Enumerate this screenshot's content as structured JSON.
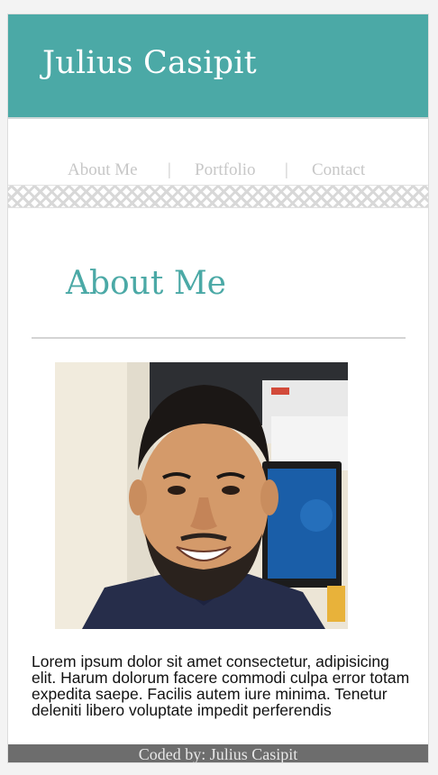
{
  "header": {
    "title": "Julius Casipit"
  },
  "nav": {
    "items": [
      {
        "label": "About Me"
      },
      {
        "label": "Portfolio"
      },
      {
        "label": "Contact"
      }
    ],
    "separator": "|"
  },
  "about": {
    "heading": "About Me",
    "bio": "Lorem ipsum dolor sit amet consectetur, adipisicing elit. Harum dolorum facere commodi culpa error totam expedita saepe. Facilis autem iure minima. Tenetur deleniti libero voluptate impedit perferendis"
  },
  "footer": {
    "text": "Coded by: Julius Casipit"
  },
  "colors": {
    "accent": "#4ba9a6",
    "nav_text": "#c7c7c7",
    "footer_bg": "#6d6d6d"
  }
}
